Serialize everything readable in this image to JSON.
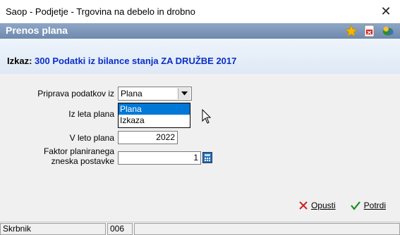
{
  "window": {
    "title": "Saop  - Podjetje - Trgovina na debelo in drobno",
    "close_label": "✕"
  },
  "header": {
    "title": "Prenos plana"
  },
  "report": {
    "label": "Izkaz:",
    "value": "300 Podatki iz bilance stanja ZA DRUŽBE 2017"
  },
  "form": {
    "source_label": "Priprava podatkov iz",
    "source_value": "Plana",
    "source_options": [
      "Plana",
      "Izkaza"
    ],
    "from_year_label": "Iz leta plana",
    "to_year_label": "V leto plana",
    "to_year_value": "2022",
    "factor_label_1": "Faktor planiranega",
    "factor_label_2": "zneska postavke",
    "factor_value": "1"
  },
  "actions": {
    "cancel_label": "Opusti",
    "confirm_label": "Potrdi"
  },
  "status": {
    "user": "Skrbnik",
    "code": "006"
  },
  "icons": {
    "favorite": "star-icon",
    "export": "pdf-icon",
    "help": "help-icon",
    "calculator": "calculator-icon",
    "cancel": "close-x-icon",
    "confirm": "checkmark-icon",
    "dropdown": "chevron-down-icon"
  },
  "colors": {
    "header_bar": "#7f96b5",
    "report_value": "#0a2ec8",
    "selection": "#0078d7",
    "cancel_x": "#d42020",
    "confirm_check": "#1e8c1e"
  }
}
